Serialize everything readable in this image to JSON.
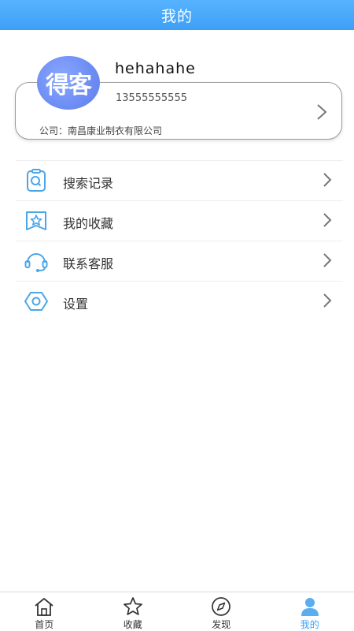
{
  "header": {
    "title": "我的"
  },
  "profile": {
    "avatar_text": "得客",
    "username": "hehahahe",
    "phone": "13555555555",
    "company_label": "公司：",
    "company_name": "南昌康业制衣有限公司"
  },
  "menu": {
    "items": [
      {
        "label": "搜索记录",
        "icon": "search-record-icon"
      },
      {
        "label": "我的收藏",
        "icon": "favorite-star-icon"
      },
      {
        "label": "联系客服",
        "icon": "headset-icon"
      },
      {
        "label": "设置",
        "icon": "settings-hexagon-icon"
      }
    ]
  },
  "bottom_nav": {
    "items": [
      {
        "label": "首页",
        "icon": "home-icon"
      },
      {
        "label": "收藏",
        "icon": "star-icon"
      },
      {
        "label": "发现",
        "icon": "compass-icon"
      },
      {
        "label": "我的",
        "icon": "user-icon",
        "active": true
      }
    ]
  },
  "colors": {
    "accent": "#3e9ff5",
    "icon_blue": "#4aa6e8",
    "avatar": "#6d8df4"
  }
}
